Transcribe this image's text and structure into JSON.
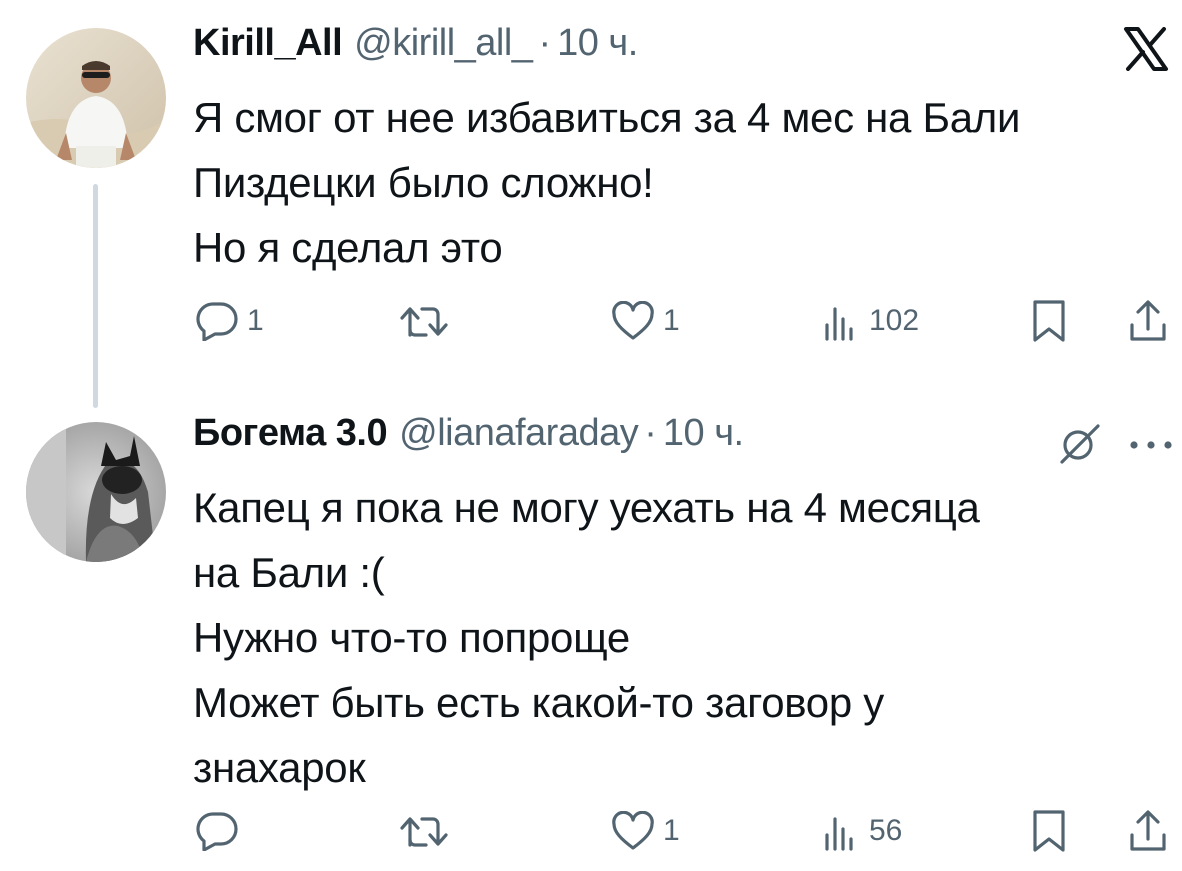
{
  "tweets": [
    {
      "name": "Kirill_All",
      "handle": "@kirill_all_",
      "separator": "·",
      "time": "10 ч.",
      "lines": [
        "Я смог от нее избавиться за 4 мес на Бали",
        "Пиздецки было сложно!",
        "Но я сделал это"
      ],
      "replies": "1",
      "retweets": "",
      "likes": "1",
      "views": "102",
      "top_icon": "x-logo-icon"
    },
    {
      "name": "Богема 3.0",
      "handle": "@lianafaraday",
      "separator": "·",
      "time": "10 ч.",
      "lines": [
        "Капец я пока не могу уехать на 4 месяца",
        "на Бали :(",
        "Нужно что-то попроще",
        "Может быть есть какой-то заговор у",
        "знахарок"
      ],
      "replies": "",
      "retweets": "",
      "likes": "1",
      "views": "56",
      "top_icon": "grok-icon",
      "more_icon": "more-options-icon"
    }
  ],
  "colors": {
    "text": "#0f1419",
    "secondary": "#536471",
    "thread_line": "#cfd9de"
  }
}
